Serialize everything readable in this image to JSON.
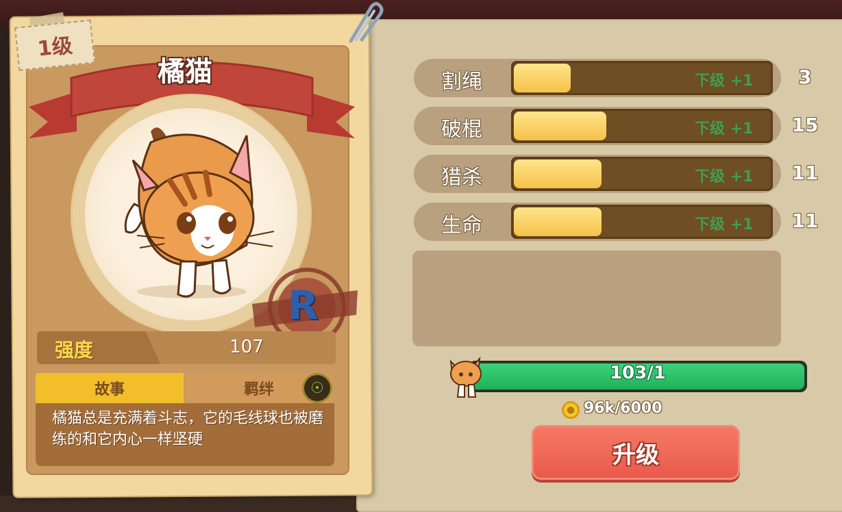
{
  "card": {
    "level": "1级",
    "name": "橘猫",
    "rarity": "R",
    "stat_label": "强度",
    "stat_value": "107",
    "tabs": [
      "故事",
      "羁绊"
    ],
    "description": "橘猫总是充满着斗志，它的毛线球也被磨练的和它内心一样坚硬"
  },
  "attributes": [
    {
      "label": "割绳",
      "next": "下级 +1",
      "value": "3",
      "progress": 0.22
    },
    {
      "label": "破棍",
      "next": "下级 +1",
      "value": "15",
      "progress": 0.36
    },
    {
      "label": "猎杀",
      "next": "下级 +1",
      "value": "11",
      "progress": 0.34
    },
    {
      "label": "生命",
      "next": "下级 +1",
      "value": "11",
      "progress": 0.34
    }
  ],
  "upgrade": {
    "shards": "103/1",
    "shard_progress": 1.0,
    "cost": "96k/6000",
    "button_label": "升级"
  },
  "colors": {
    "accent_red": "#e9594a",
    "progress_green": "#22b05a",
    "bar_gold": "#f5c14a",
    "ribbon_red": "#c0453a"
  }
}
